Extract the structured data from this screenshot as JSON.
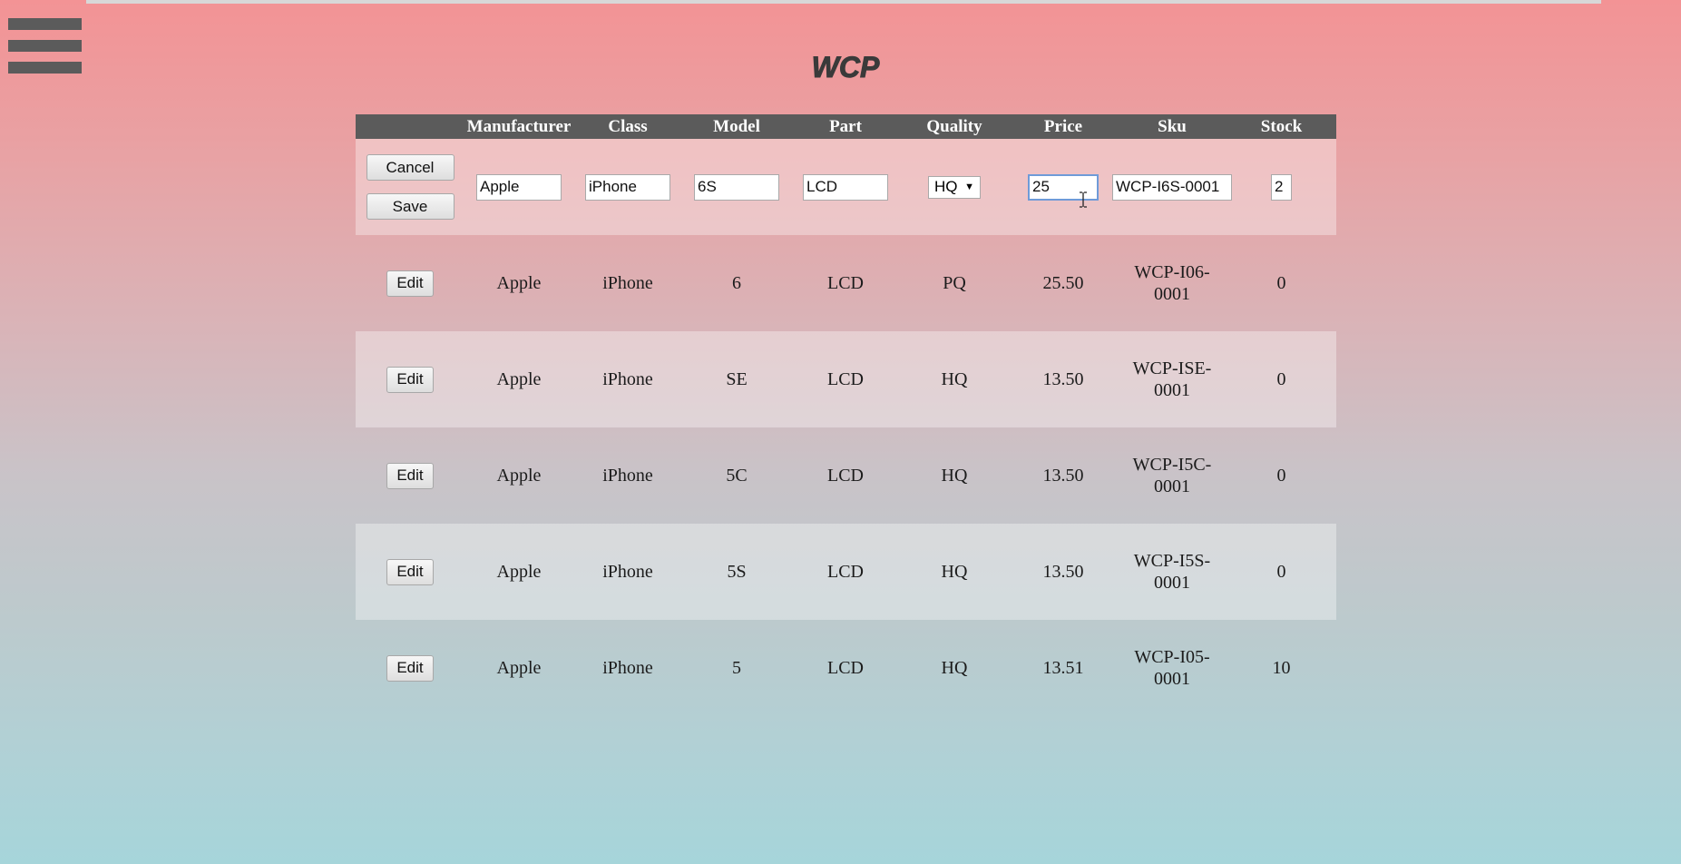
{
  "brand": {
    "logo_text": "WCP"
  },
  "table": {
    "headers": [
      "",
      "Manufacturer",
      "Class",
      "Model",
      "Part",
      "Quality",
      "Price",
      "Sku",
      "Stock"
    ],
    "edit_row": {
      "cancel_label": "Cancel",
      "save_label": "Save",
      "manufacturer": "Apple",
      "class": "iPhone",
      "model": "6S",
      "part": "LCD",
      "quality": "HQ",
      "price": "25",
      "sku": "WCP-I6S-0001",
      "stock": "2"
    },
    "rows": [
      {
        "edit_label": "Edit",
        "manufacturer": "Apple",
        "class": "iPhone",
        "model": "6",
        "part": "LCD",
        "quality": "PQ",
        "price": "25.50",
        "sku": "WCP-I06-0001",
        "stock": "0"
      },
      {
        "edit_label": "Edit",
        "manufacturer": "Apple",
        "class": "iPhone",
        "model": "SE",
        "part": "LCD",
        "quality": "HQ",
        "price": "13.50",
        "sku": "WCP-ISE-0001",
        "stock": "0"
      },
      {
        "edit_label": "Edit",
        "manufacturer": "Apple",
        "class": "iPhone",
        "model": "5C",
        "part": "LCD",
        "quality": "HQ",
        "price": "13.50",
        "sku": "WCP-I5C-0001",
        "stock": "0"
      },
      {
        "edit_label": "Edit",
        "manufacturer": "Apple",
        "class": "iPhone",
        "model": "5S",
        "part": "LCD",
        "quality": "HQ",
        "price": "13.50",
        "sku": "WCP-I5S-0001",
        "stock": "0"
      },
      {
        "edit_label": "Edit",
        "manufacturer": "Apple",
        "class": "iPhone",
        "model": "5",
        "part": "LCD",
        "quality": "HQ",
        "price": "13.51",
        "sku": "WCP-I05-0001",
        "stock": "10"
      }
    ]
  },
  "icons": {
    "menu": "hamburger-menu-icon",
    "select_caret": "caret-down-icon",
    "text_cursor": "text-cursor-icon"
  },
  "colors": {
    "header_bg": "#5b5b5b",
    "menu_icon": "#5b5b5b",
    "focus_border": "#6f9bd8"
  }
}
